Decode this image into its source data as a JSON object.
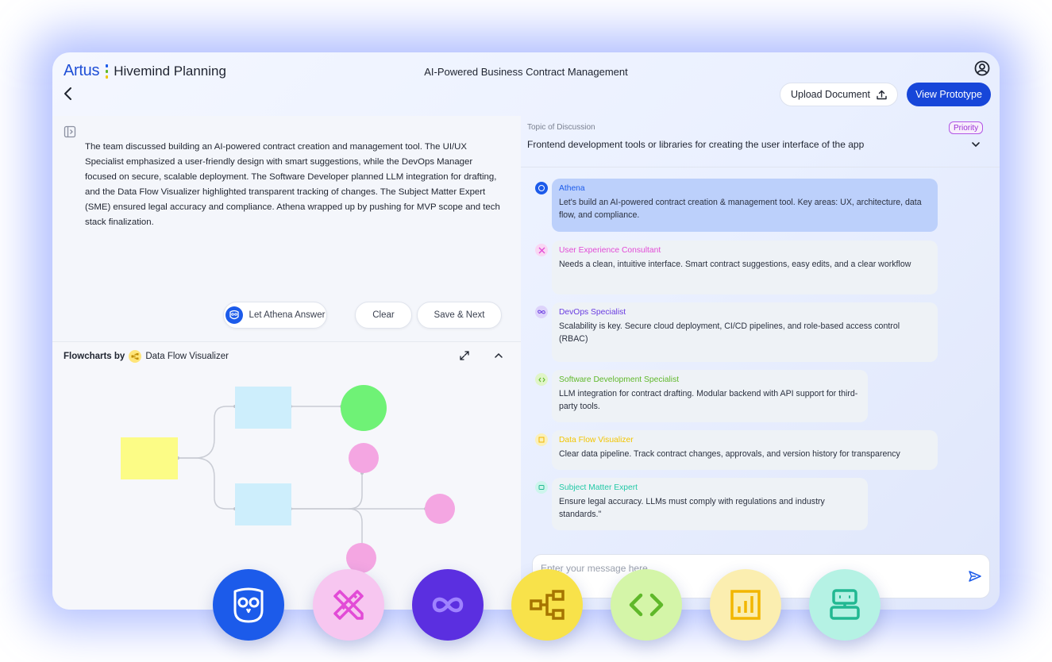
{
  "header": {
    "brand_artus": "Artus",
    "brand_name": "Hivemind Planning",
    "page_title": "AI-Powered Business Contract Management",
    "upload_label": "Upload Document",
    "prototype_label": "View Prototype"
  },
  "summary": {
    "text": "The team discussed building an AI-powered contract creation and management tool. The UI/UX Specialist emphasized a user-friendly design with smart suggestions, while the DevOps Manager focused on secure, scalable deployment. The Software Developer planned LLM integration for drafting, and the Data Flow Visualizer highlighted transparent tracking of changes. The Subject Matter Expert (SME) ensured legal accuracy and compliance. Athena wrapped up by pushing for MVP scope and tech stack finalization."
  },
  "actions": {
    "athena_answer": "Let Athena Answer",
    "clear": "Clear",
    "save_next": "Save & Next"
  },
  "flowchart": {
    "title_prefix": "Flowcharts by",
    "title_agent": "Data Flow Visualizer",
    "colors": {
      "start_node": "#fcfc86",
      "process_node": "#cdeefc",
      "end_node_green": "#6ff276",
      "end_node_pink": "#f4a6e2"
    }
  },
  "discussion": {
    "topic_label": "Topic of Discussion",
    "priority": "Priority",
    "topic": "Frontend development tools or libraries for creating the user interface of the app",
    "messages": [
      {
        "sender": "Athena",
        "color": "#1c5bea",
        "text": "Let's build an AI-powered contract creation & management tool. Key areas: UX, architecture, data flow, and compliance."
      },
      {
        "sender": "User Experience Consultant",
        "color": "#e24bd6",
        "text": "Needs a clean, intuitive interface. Smart contract suggestions, easy edits, and a clear workflow"
      },
      {
        "sender": "DevOps Specialist",
        "color": "#6a3de0",
        "text": "Scalability is key. Secure cloud deployment, CI/CD pipelines, and role-based access control (RBAC)"
      },
      {
        "sender": "Software Development Specialist",
        "color": "#5fb82a",
        "text": "LLM integration for contract drafting. Modular backend with API support for third-party tools."
      },
      {
        "sender": "Data Flow Visualizer",
        "color": "#f2c500",
        "text": "Clear data pipeline. Track contract changes, approvals, and version history for transparency"
      },
      {
        "sender": "Subject Matter Expert",
        "color": "#22c9a6",
        "text": "Ensure legal accuracy. LLMs must comply with regulations and industry standards.\""
      }
    ],
    "input_placeholder": "Enter your message here"
  },
  "agents": [
    {
      "name": "athena-owl-icon",
      "bg": "#1c5bea",
      "fg": "#ffffff"
    },
    {
      "name": "ux-consultant-icon",
      "bg": "#f7c6f0",
      "fg": "#e24bd6"
    },
    {
      "name": "devops-infinity-icon",
      "bg": "#5b2fe0",
      "fg": "#9f82ff"
    },
    {
      "name": "data-flow-icon",
      "bg": "#f8e24a",
      "fg": "#c08c00"
    },
    {
      "name": "code-icon",
      "bg": "#d4f5a8",
      "fg": "#5fb82a"
    },
    {
      "name": "chart-icon",
      "bg": "#fbeeb0",
      "fg": "#f2b600"
    },
    {
      "name": "sme-robot-icon",
      "bg": "#b5f2e4",
      "fg": "#22b892"
    }
  ]
}
